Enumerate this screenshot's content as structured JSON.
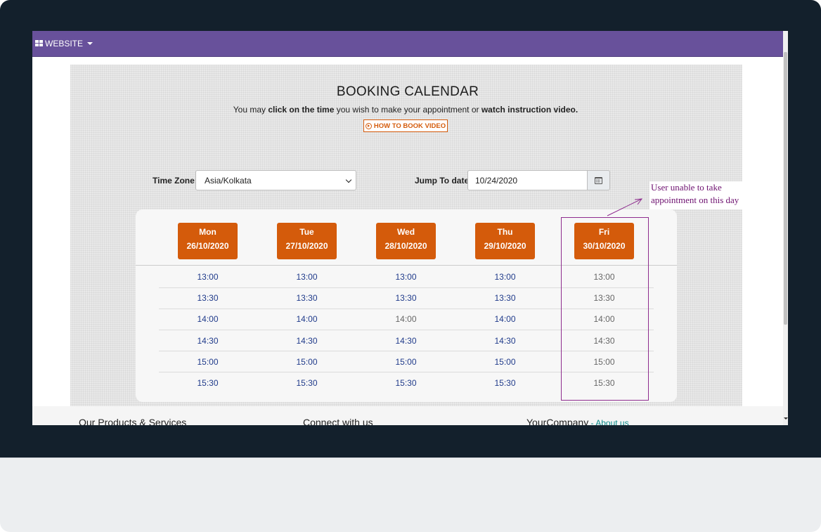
{
  "navbar": {
    "menu_label": "WEBSITE"
  },
  "booking": {
    "title": "BOOKING CALENDAR",
    "subtitle": {
      "part1": "You may ",
      "bold1": "click on the time",
      "part2": " you wish to make your appointment or ",
      "bold2": "watch instruction video."
    },
    "video_button": "HOW TO BOOK VIDEO"
  },
  "filters": {
    "timezone_label": "Time Zone:",
    "timezone_value": "Asia/Kolkata",
    "date_label": "Jump To date:",
    "date_value": "10/24/2020"
  },
  "days": [
    {
      "name": "Mon",
      "date": "26/10/2020",
      "slots": [
        {
          "time": "13:00",
          "available": true
        },
        {
          "time": "13:30",
          "available": true
        },
        {
          "time": "14:00",
          "available": true
        },
        {
          "time": "14:30",
          "available": true
        },
        {
          "time": "15:00",
          "available": true
        },
        {
          "time": "15:30",
          "available": true
        }
      ]
    },
    {
      "name": "Tue",
      "date": "27/10/2020",
      "slots": [
        {
          "time": "13:00",
          "available": true
        },
        {
          "time": "13:30",
          "available": true
        },
        {
          "time": "14:00",
          "available": true
        },
        {
          "time": "14:30",
          "available": true
        },
        {
          "time": "15:00",
          "available": true
        },
        {
          "time": "15:30",
          "available": true
        }
      ]
    },
    {
      "name": "Wed",
      "date": "28/10/2020",
      "slots": [
        {
          "time": "13:00",
          "available": true
        },
        {
          "time": "13:30",
          "available": true
        },
        {
          "time": "14:00",
          "available": false
        },
        {
          "time": "14:30",
          "available": true
        },
        {
          "time": "15:00",
          "available": true
        },
        {
          "time": "15:30",
          "available": true
        }
      ]
    },
    {
      "name": "Thu",
      "date": "29/10/2020",
      "slots": [
        {
          "time": "13:00",
          "available": true
        },
        {
          "time": "13:30",
          "available": true
        },
        {
          "time": "14:00",
          "available": true
        },
        {
          "time": "14:30",
          "available": true
        },
        {
          "time": "15:00",
          "available": true
        },
        {
          "time": "15:30",
          "available": true
        }
      ]
    },
    {
      "name": "Fri",
      "date": "30/10/2020",
      "slots": [
        {
          "time": "13:00",
          "available": false
        },
        {
          "time": "13:30",
          "available": false
        },
        {
          "time": "14:00",
          "available": false
        },
        {
          "time": "14:30",
          "available": false
        },
        {
          "time": "15:00",
          "available": false
        },
        {
          "time": "15:30",
          "available": false
        }
      ]
    }
  ],
  "annotation": {
    "line1": "User  unable  to  take",
    "line2": "appointment  on  this  day"
  },
  "footer": {
    "col1": "Our Products & Services",
    "col2": "Connect with us",
    "col3_title": "YourCompany",
    "col3_sep": " - ",
    "col3_link": "About us"
  },
  "colors": {
    "navbar": "#68519b",
    "accent": "#d45b0b",
    "available_slot": "#1f3a8a",
    "unavailable_slot": "#666666",
    "annotation": "#8e2c8e",
    "bezel": "#13202c"
  }
}
